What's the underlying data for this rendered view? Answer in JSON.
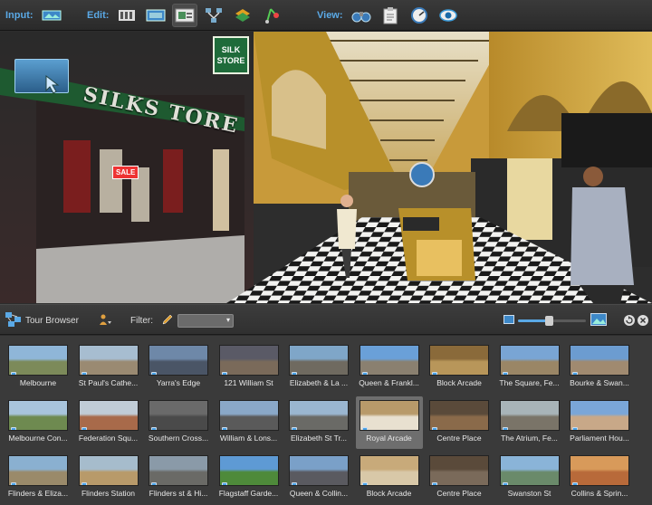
{
  "toolbar": {
    "input_label": "Input:",
    "edit_label": "Edit:",
    "view_label": "View:",
    "input_buttons": [
      "panorama-import-icon"
    ],
    "edit_buttons": [
      "film-strip-icon",
      "stitch-icon",
      "hotspot-icon",
      "tour-map-icon",
      "layers-icon",
      "path-icon"
    ],
    "view_buttons": [
      "binoculars-icon",
      "clipboard-icon",
      "speed-dial-icon",
      "eye-icon"
    ]
  },
  "viewer": {
    "shop_sign": "SILK STORE",
    "storefront_text": "SILKS TORE",
    "sale_tag": "SALE"
  },
  "browser": {
    "title": "Tour Browser",
    "filter_label": "Filter:",
    "filter_value": "",
    "zoom_level": 0.45
  },
  "tours": [
    {
      "label": "Melbourne",
      "sky": "#8fb6d8",
      "ground": "#7c8a5a"
    },
    {
      "label": "St Paul's Cathe...",
      "sky": "#a7bdd0",
      "ground": "#9a8a72"
    },
    {
      "label": "Yarra's Edge",
      "sky": "#6e88a8",
      "ground": "#4a5566"
    },
    {
      "label": "121 William St",
      "sky": "#5a5a66",
      "ground": "#7a6a5a"
    },
    {
      "label": "Elizabeth & La ...",
      "sky": "#7fa6c8",
      "ground": "#6f6a60"
    },
    {
      "label": "Queen & Frankl...",
      "sky": "#6aa0d8",
      "ground": "#8a8070"
    },
    {
      "label": "Block Arcade",
      "sky": "#8a6a3a",
      "ground": "#b8965a"
    },
    {
      "label": "The Square, Fe...",
      "sky": "#79a5d4",
      "ground": "#9a8666"
    },
    {
      "label": "Bourke & Swan...",
      "sky": "#6c9cd0",
      "ground": "#a08a70"
    },
    {
      "label": "Melbourne Con...",
      "sky": "#a8c4dc",
      "ground": "#6e8a50"
    },
    {
      "label": "Federation Squ...",
      "sky": "#c0ccd6",
      "ground": "#a86a4a"
    },
    {
      "label": "Southern Cross...",
      "sky": "#6a6a6a",
      "ground": "#4a4a4a"
    },
    {
      "label": "William & Lons...",
      "sky": "#8aa8c8",
      "ground": "#5a5a5a"
    },
    {
      "label": "Elizabeth St Tr...",
      "sky": "#9ab6d0",
      "ground": "#6a6a66"
    },
    {
      "label": "Royal Arcade",
      "sky": "#b89a6a",
      "ground": "#e8e0d0"
    },
    {
      "label": "Centre Place",
      "sky": "#5a4a3a",
      "ground": "#8a6a4a"
    },
    {
      "label": "The Atrium, Fe...",
      "sky": "#a8b4b8",
      "ground": "#7a7468"
    },
    {
      "label": "Parliament Hou...",
      "sky": "#7aa6d8",
      "ground": "#c8a888"
    },
    {
      "label": "Flinders & Eliza...",
      "sky": "#8ab0d0",
      "ground": "#9a8a6a"
    },
    {
      "label": "Flinders Station",
      "sky": "#a6bccc",
      "ground": "#b89a6a"
    },
    {
      "label": "Flinders st & Hi...",
      "sky": "#8a9aa8",
      "ground": "#6a6a66"
    },
    {
      "label": "Flagstaff Garde...",
      "sky": "#5e9ad4",
      "ground": "#4e8a3a"
    },
    {
      "label": "Queen & Collin...",
      "sky": "#7aa0c8",
      "ground": "#5a5a60"
    },
    {
      "label": "Block Arcade",
      "sky": "#c8aa7a",
      "ground": "#d8c8a8"
    },
    {
      "label": "Centre Place",
      "sky": "#5a4a3a",
      "ground": "#7a6a5a"
    },
    {
      "label": "Swanston St",
      "sky": "#8ab4d8",
      "ground": "#6a8a6a"
    },
    {
      "label": "Collins & Sprin...",
      "sky": "#d89a5a",
      "ground": "#b86a3a"
    }
  ],
  "selected_index": 14
}
